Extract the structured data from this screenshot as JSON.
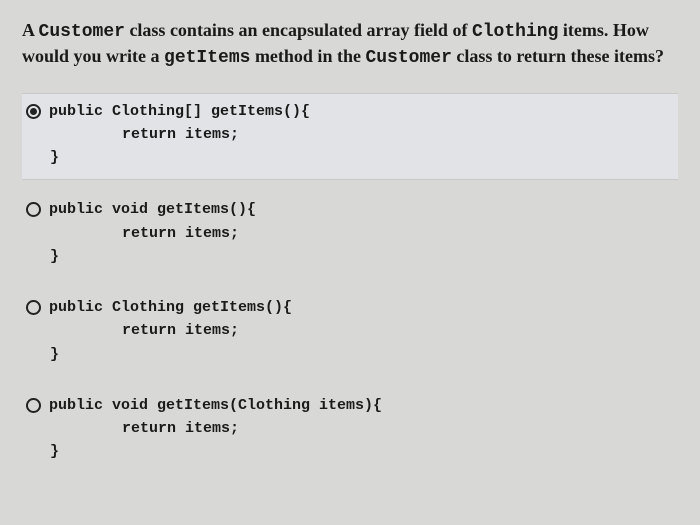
{
  "question": {
    "part1": "A ",
    "code1": "Customer",
    "part2": " class contains an encapsulated array field of ",
    "code2": "Clothing",
    "part3": " items. How would you write a ",
    "code3": "getItems",
    "part4": " method in the ",
    "code4": "Customer",
    "part5": " class to return these items?"
  },
  "options": [
    {
      "selected": true,
      "sig": "public Clothing[] getItems(){",
      "body": "        return items;\n}"
    },
    {
      "selected": false,
      "sig": "public void getItems(){",
      "body": "        return items;\n}"
    },
    {
      "selected": false,
      "sig": "public Clothing getItems(){",
      "body": "        return items;\n}"
    },
    {
      "selected": false,
      "sig": "public void getItems(Clothing items){",
      "body": "        return items;\n}"
    }
  ]
}
